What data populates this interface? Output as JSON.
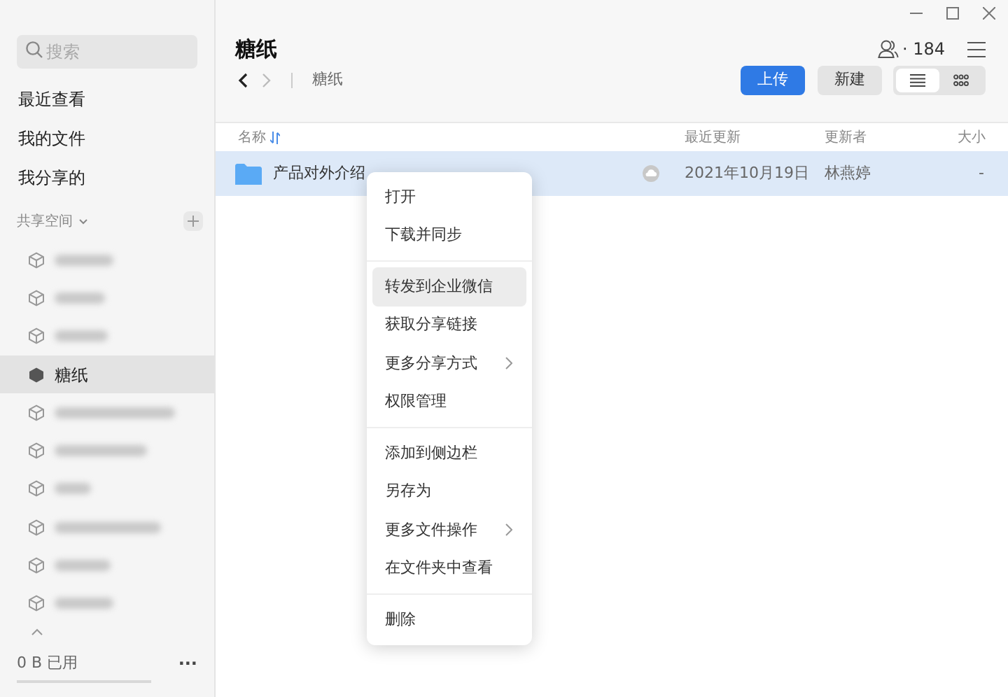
{
  "sidebar": {
    "search": {
      "placeholder": "搜索"
    },
    "nav": [
      {
        "label": "最近查看"
      },
      {
        "label": "我的文件"
      },
      {
        "label": "我分享的"
      }
    ],
    "section": {
      "label": "共享空间",
      "expanded": true
    },
    "spaces": [
      {
        "kind": "redacted",
        "selected": false
      },
      {
        "kind": "redacted",
        "selected": false
      },
      {
        "kind": "redacted",
        "selected": false
      },
      {
        "kind": "named",
        "label": "糖纸",
        "selected": true
      },
      {
        "kind": "redacted",
        "selected": false
      },
      {
        "kind": "redacted",
        "selected": false
      },
      {
        "kind": "redacted",
        "selected": false
      },
      {
        "kind": "redacted",
        "selected": false
      },
      {
        "kind": "redacted",
        "selected": false
      },
      {
        "kind": "redacted",
        "selected": false
      }
    ],
    "storage": {
      "label": "0 B 已用"
    },
    "more": "..."
  },
  "header": {
    "title": "糖纸",
    "breadcrumb": "糖纸",
    "members": "· 184",
    "upload": "上传",
    "new": "新建",
    "views": [
      {
        "kind": "list",
        "selected": true
      },
      {
        "kind": "grid",
        "selected": false
      }
    ]
  },
  "table": {
    "columns": [
      "名称",
      "最近更新",
      "更新者",
      "大小"
    ],
    "rows": [
      {
        "kind": "folder",
        "name": "产品对外介绍",
        "updated": "2021年10月19日",
        "updater": "林燕婷",
        "size": "-",
        "selected": true
      }
    ]
  },
  "context_menu": {
    "groups": [
      [
        {
          "label": "打开",
          "submenu": false,
          "highlighted": false
        },
        {
          "label": "下载并同步",
          "submenu": false,
          "highlighted": false
        }
      ],
      [
        {
          "label": "转发到企业微信",
          "submenu": false,
          "highlighted": true
        },
        {
          "label": "获取分享链接",
          "submenu": false,
          "highlighted": false
        },
        {
          "label": "更多分享方式",
          "submenu": true,
          "highlighted": false
        },
        {
          "label": "权限管理",
          "submenu": false,
          "highlighted": false
        }
      ],
      [
        {
          "label": "添加到侧边栏",
          "submenu": false,
          "highlighted": false
        },
        {
          "label": "另存为",
          "submenu": false,
          "highlighted": false
        },
        {
          "label": "更多文件操作",
          "submenu": true,
          "highlighted": false
        },
        {
          "label": "在文件夹中查看",
          "submenu": false,
          "highlighted": false
        }
      ],
      [
        {
          "label": "删除",
          "submenu": false,
          "highlighted": false
        }
      ]
    ]
  }
}
